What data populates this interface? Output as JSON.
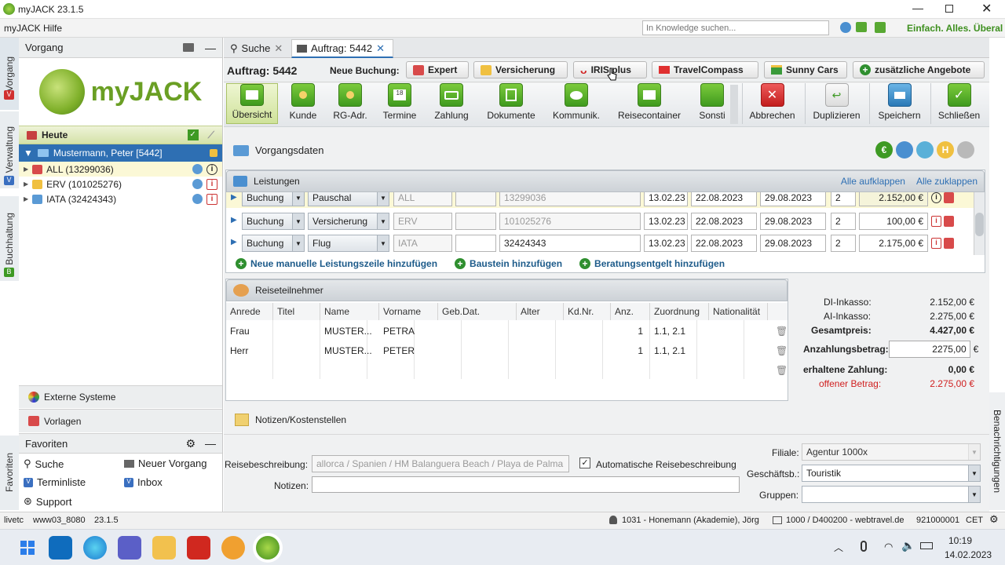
{
  "window": {
    "title": "myJACK 23.1.5"
  },
  "menu": {
    "items": [
      "myJACK",
      "Hilfe"
    ],
    "search_placeholder": "In Knowledge suchen...",
    "slogan": "Einfach. Alles. Überal"
  },
  "vtabs": {
    "vorgang": "Vorgang",
    "verwaltung": "Verwaltung",
    "buchhaltung": "Buchhaltung",
    "favoriten": "Favoriten",
    "benachrichtigungen": "Benachrichtigungen"
  },
  "left": {
    "panel_title": "Vorgang",
    "logo_text": "myJACK",
    "heute": "Heute",
    "customer": "Mustermann, Peter [5442]",
    "tree": [
      {
        "label": "ALL (13299036)"
      },
      {
        "label": "ERV (101025276)"
      },
      {
        "label": "IATA (32424343)"
      }
    ],
    "externe": "Externe Systeme",
    "vorlagen": "Vorlagen",
    "favoriten_title": "Favoriten",
    "fav": {
      "suche": "Suche",
      "neuer_vorgang": "Neuer Vorgang",
      "terminliste": "Terminliste",
      "inbox": "Inbox",
      "support": "Support"
    }
  },
  "tabs": {
    "suche": "Suche",
    "auftrag": "Auftrag: 5442"
  },
  "order": {
    "title": "Auftrag: 5442",
    "neue_buchung": "Neue Buchung:"
  },
  "booking_buttons": [
    "Expert",
    "Versicherung",
    "IRIS.plus",
    "TravelCompass",
    "Sunny Cars",
    "zusätzliche Angebote"
  ],
  "toolbar": [
    "Übersicht",
    "Kunde",
    "RG-Adr.",
    "Termine",
    "Zahlung",
    "Dokumente",
    "Kommunik.",
    "Reisecontainer",
    "Sonsti"
  ],
  "actions": [
    "Abbrechen",
    "Duplizieren",
    "Speichern",
    "Schließen"
  ],
  "vorgangsdaten": "Vorgangsdaten",
  "leistungen": {
    "title": "Leistungen",
    "expand_all": "Alle aufklappen",
    "collapse_all": "Alle zuklappen",
    "rows": [
      {
        "type": "Buchung",
        "kind": "Pauschal",
        "code": "ALL",
        "nr": "13299036",
        "date1": "13.02.23",
        "date2": "22.08.2023",
        "date3": "29.08.2023",
        "count": "2",
        "price": "2.152,00 €"
      },
      {
        "type": "Buchung",
        "kind": "Versicherung",
        "code": "ERV",
        "nr": "101025276",
        "date1": "13.02.23",
        "date2": "22.08.2023",
        "date3": "29.08.2023",
        "count": "2",
        "price": "100,00 €"
      },
      {
        "type": "Buchung",
        "kind": "Flug",
        "code": "IATA",
        "nr": "32424343",
        "date1": "13.02.23",
        "date2": "22.08.2023",
        "date3": "29.08.2023",
        "count": "2",
        "price": "2.175,00 €"
      }
    ],
    "add_links": [
      "Neue manuelle Leistungszeile hinzufügen",
      "Baustein hinzufügen",
      "Beratungsentgelt hinzufügen"
    ]
  },
  "reiseteilnehmer": {
    "title": "Reiseteilnehmer",
    "columns": [
      "Anrede",
      "Titel",
      "Name",
      "Vorname",
      "Geb.Dat.",
      "Alter",
      "Kd.Nr.",
      "Anz.",
      "Zuordnung",
      "Nationalität"
    ],
    "rows": [
      {
        "anrede": "Frau",
        "name": "MUSTER...",
        "vorname": "PETRA",
        "anz": "1",
        "zuordnung": "1.1, 2.1"
      },
      {
        "anrede": "Herr",
        "name": "MUSTER...",
        "vorname": "PETER",
        "anz": "1",
        "zuordnung": "1.1, 2.1"
      }
    ]
  },
  "summary": {
    "di_label": "DI-Inkasso:",
    "di_value": "2.152,00 €",
    "ai_label": "AI-Inkasso:",
    "ai_value": "2.275,00 €",
    "gesamt_label": "Gesamtpreis:",
    "gesamt_value": "4.427,00 €",
    "anzahlung_label": "Anzahlungsbetrag:",
    "anzahlung_value": "2275,00",
    "currency": "€",
    "erhalten_label": "erhaltene Zahlung:",
    "erhalten_value": "0,00 €",
    "offen_label": "offener Betrag:",
    "offen_value": "2.275,00 €"
  },
  "notizen_header": "Notizen/Kostenstellen",
  "bottom": {
    "reisebeschreibung_label": "Reisebeschreibung:",
    "reisebeschreibung_value": "allorca / Spanien / HM Balanguera Beach / Playa de Palma",
    "auto_label": "Automatische Reisebeschreibung",
    "notizen_label": "Notizen:",
    "filiale_label": "Filiale:",
    "filiale_value": "Agentur 1000x",
    "geschaeftsb_label": "Geschäftsb.:",
    "geschaeftsb_value": "Touristik",
    "gruppen_label": "Gruppen:"
  },
  "status": {
    "env": "livetc",
    "server": "www03_8080",
    "version": "23.1.5",
    "user": "1031 - Honemann (Akademie), Jörg",
    "agency": "1000 / D400200 - webtravel.de",
    "id": "921000001",
    "tz": "CET"
  },
  "taskbar": {
    "time": "10:19",
    "date": "14.02.2023"
  },
  "colors": {
    "green": "#3f9a1e",
    "red": "#d02020",
    "blue_head": "#c9d2db",
    "accent": "#5aa02c"
  }
}
